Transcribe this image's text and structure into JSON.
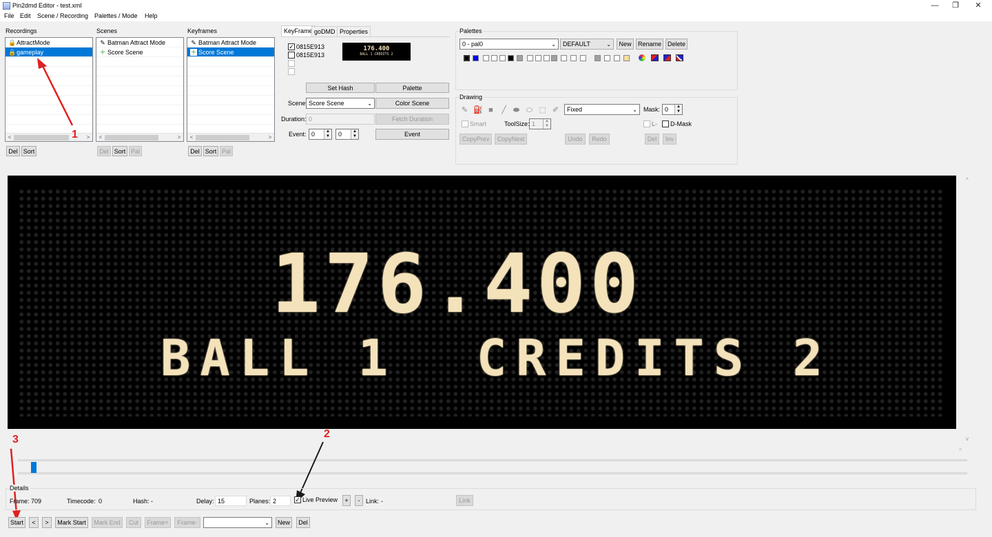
{
  "window": {
    "title": "Pin2dmd Editor  - test.xml",
    "minimize": "—",
    "maximize": "❐",
    "close": "✕"
  },
  "menu": [
    "File",
    "Edit",
    "Scene / Recording",
    "Palettes / Mode",
    "Help"
  ],
  "recordings": {
    "label": "Recordings",
    "items": [
      {
        "label": "AttractMode",
        "icon": "lock-icon"
      },
      {
        "label": "gameplay",
        "icon": "lock-icon",
        "selected": true
      }
    ],
    "buttons": [
      "Del",
      "Sort"
    ]
  },
  "scenes": {
    "label": "Scenes",
    "items": [
      {
        "label": "Batman Attract Mode",
        "icon": "edit-icon"
      },
      {
        "label": "Score Scene",
        "icon": "add-icon"
      }
    ],
    "buttons": [
      "Del",
      "Sort",
      "Pal"
    ]
  },
  "keyframes": {
    "label": "Keyframes",
    "items": [
      {
        "label": "Batman Attract Mode",
        "icon": "edit-icon"
      },
      {
        "label": "Score Scene",
        "icon": "add-icon",
        "selected": true
      }
    ],
    "buttons": [
      "Del",
      "Sort",
      "Pal"
    ]
  },
  "tabs": [
    "KeyFrame",
    "goDMD",
    "Properties"
  ],
  "keyframe_panel": {
    "hashes": [
      {
        "label": "0815E913",
        "checked": true
      },
      {
        "label": "0815E913",
        "checked": false
      },
      {
        "label": "",
        "checked": false
      },
      {
        "label": "",
        "checked": false
      }
    ],
    "preview_line1": "176.400",
    "preview_line2": "BALL 1  CREDITS 2",
    "set_hash": "Set Hash",
    "palette_btn": "Palette",
    "scene_label": "Scene:",
    "scene_value": "Score Scene",
    "color_scene": "Color Scene",
    "duration_label": "Duration:",
    "duration_value": "0",
    "fetch_duration": "Fetch Duration",
    "event_label": "Event:",
    "event_value1": "0",
    "event_value2": "0",
    "event_btn": "Event"
  },
  "palettes": {
    "label": "Palettes",
    "selected": "0 - pal0",
    "type": "DEFAULT",
    "buttons": [
      "New",
      "Rename",
      "Delete"
    ],
    "swatches": [
      "#000000",
      "#0000ff",
      "#ffffff",
      "#ffffff",
      "#ffffff",
      "#000000",
      "#a0a0a0",
      "#ffffff",
      "#ffffff",
      "#ffffff",
      "#a0a0a0",
      "#ffffff",
      "#ffffff",
      "#ffffff",
      "#a0a0a0",
      "#ffffff",
      "#ffffff",
      "#ffffff",
      "#f8e0a0"
    ]
  },
  "drawing": {
    "label": "Drawing",
    "fill_mode": "Fixed",
    "mask_label": "Mask:",
    "mask_value": "0",
    "smart_label": "Smart",
    "toolsize_label": "ToolSize:",
    "toolsize_value": "1",
    "l_label": "L-",
    "dmask_label": "D-Mask",
    "buttons": [
      "CopyPrev",
      "CopyNext",
      "Undo",
      "Redo",
      "Del",
      "Inv"
    ]
  },
  "dmd": {
    "line1": "176.400",
    "line2": "BALL 1  CREDITS 2"
  },
  "annotations": [
    "1",
    "2",
    "3"
  ],
  "details": {
    "label": "Details",
    "frame_label": "Frame:",
    "frame_value": "709",
    "timecode_label": "Timecode:",
    "timecode_value": "0",
    "hash_label": "Hash:",
    "hash_value": "-",
    "delay_label": "Delay:",
    "delay_value": "15",
    "planes_label": "Planes:",
    "planes_value": "2",
    "live_preview_label": "Live Preview",
    "live_preview_checked": true,
    "plus": "+",
    "minus": "-",
    "link_label": "Link:",
    "link_value": "-",
    "link_button": "Link"
  },
  "bottom_buttons": [
    "Start",
    "<",
    ">",
    "Mark Start",
    "Mark End",
    "Cut",
    "Frame+",
    "Frame-",
    "New",
    "Del"
  ],
  "bottom_combo": ""
}
